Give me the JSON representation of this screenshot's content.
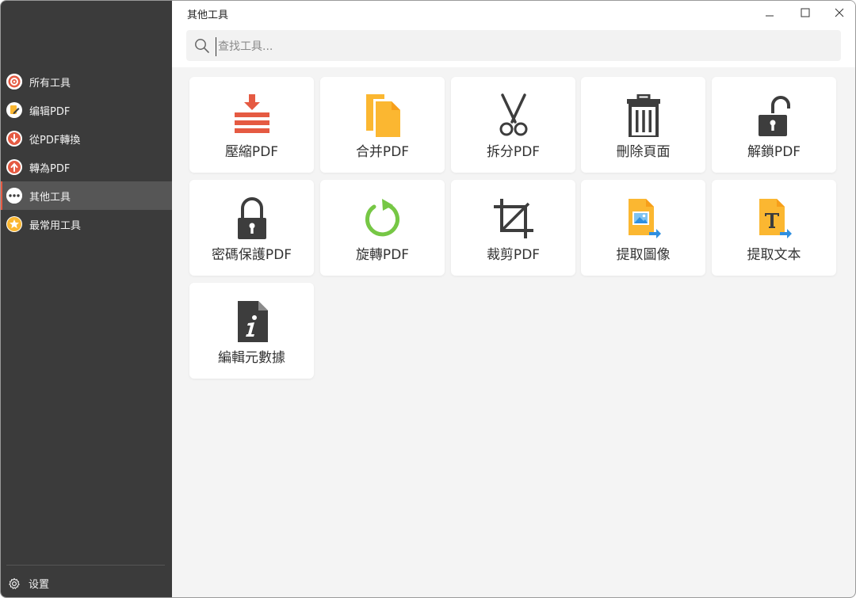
{
  "window": {
    "title": "其他工具",
    "controls": {
      "minimize": "minimize-icon",
      "maximize": "maximize-icon",
      "close": "close-icon"
    }
  },
  "search": {
    "placeholder": "查找工具...",
    "value": ""
  },
  "sidebar": {
    "items": [
      {
        "label": "所有工具",
        "icon": "all-tools-icon"
      },
      {
        "label": "编辑PDF",
        "icon": "edit-pdf-icon"
      },
      {
        "label": "從PDF轉換",
        "icon": "convert-from-pdf-icon"
      },
      {
        "label": "轉為PDF",
        "icon": "convert-to-pdf-icon"
      },
      {
        "label": "其他工具",
        "icon": "more-tools-icon",
        "active": true
      },
      {
        "label": "最常用工具",
        "icon": "star-icon"
      }
    ],
    "settings_label": "设置"
  },
  "tools": [
    {
      "label": "壓縮PDF",
      "icon": "compress-icon"
    },
    {
      "label": "合并PDF",
      "icon": "merge-icon"
    },
    {
      "label": "拆分PDF",
      "icon": "scissors-icon"
    },
    {
      "label": "刪除頁面",
      "icon": "trash-icon"
    },
    {
      "label": "解鎖PDF",
      "icon": "unlock-icon"
    },
    {
      "label": "密碼保護PDF",
      "icon": "lock-icon"
    },
    {
      "label": "旋轉PDF",
      "icon": "rotate-icon"
    },
    {
      "label": "裁剪PDF",
      "icon": "crop-icon"
    },
    {
      "label": "提取圖像",
      "icon": "extract-image-icon"
    },
    {
      "label": "提取文本",
      "icon": "extract-text-icon"
    },
    {
      "label": "編輯元數據",
      "icon": "metadata-icon"
    }
  ],
  "colors": {
    "sidebar_bg": "#3b3b3b",
    "sidebar_active_bg": "#565656",
    "accent_red": "#e55a42",
    "accent_yellow": "#fbb731",
    "accent_green": "#76c745",
    "icon_dark": "#3d3d3d",
    "arrow_blue": "#2f8fe0"
  }
}
